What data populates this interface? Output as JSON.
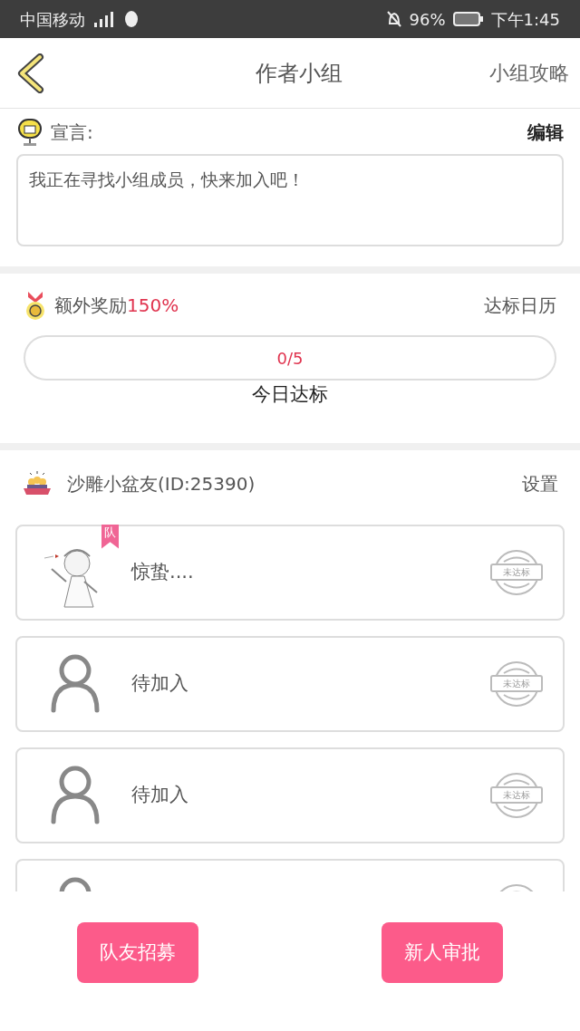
{
  "status_bar": {
    "carrier": "中国移动",
    "battery": "96%",
    "time": "下午1:45"
  },
  "header": {
    "title": "作者小组",
    "action": "小组攻略"
  },
  "declaration": {
    "label": "宣言:",
    "edit": "编辑",
    "text": "我正在寻找小组成员，快来加入吧！"
  },
  "reward": {
    "label": "额外奖励",
    "bonus": "150%",
    "calendar": "达标日历",
    "progress": {
      "text": "0/5",
      "level": 0
    },
    "today": "今日达标"
  },
  "group": {
    "name": "沙雕小盆友(ID:25390)",
    "settings": "设置"
  },
  "members": [
    {
      "kind": "picture",
      "name": "惊蛰....",
      "badge": "队",
      "stamp": "未达标"
    },
    {
      "kind": "empty",
      "name": "待加入",
      "stamp": "未达标"
    },
    {
      "kind": "empty",
      "name": "待加入",
      "stamp": "未达标"
    },
    {
      "kind": "empty"
    }
  ],
  "buttons": [
    "队友招募",
    "新人审批"
  ]
}
